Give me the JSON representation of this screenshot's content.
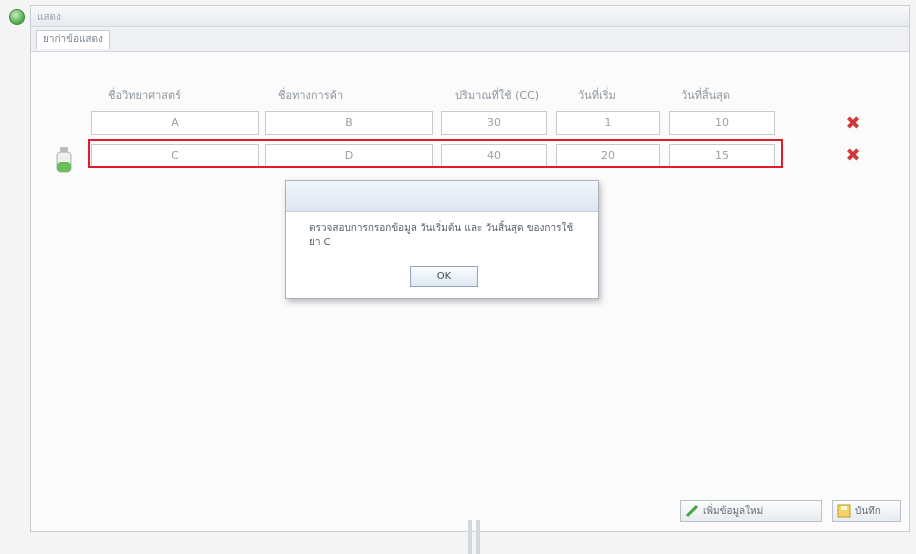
{
  "window": {
    "title": "แสดง"
  },
  "tab": {
    "label": "ยาก่าข้อแสดง"
  },
  "table": {
    "headers": [
      "ชื่อวิทยาศาสตร์",
      "ชื่อทางการค้า",
      "ปริมาณที่ใช้ (CC)",
      "วันที่เริ่ม",
      "วันที่สิ้นสุด"
    ],
    "rows": [
      [
        "A",
        "B",
        "30",
        "1",
        "10"
      ],
      [
        "C",
        "D",
        "40",
        "20",
        "15"
      ]
    ]
  },
  "dialog": {
    "message": "ตรวจสอบการกรอกข้อมูล วันเริ่มต้น และ วันสิ้นสุด ของการใช้ยา C",
    "ok_label": "OK"
  },
  "footer": {
    "add_label": "เพิ่มข้อมูลใหม่",
    "save_label": "บันทึก"
  },
  "colors": {
    "highlight": "#e01c2c",
    "delete": "#d23a3a"
  },
  "icons": [
    "app-status-icon",
    "delete-icon",
    "medicine-bottle-icon",
    "add-icon",
    "save-icon"
  ]
}
